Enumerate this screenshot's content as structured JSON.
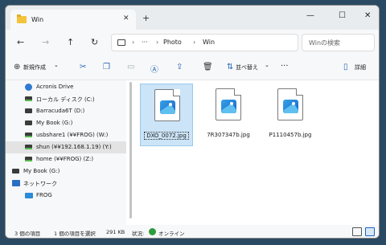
{
  "window": {
    "tab_title": "Win",
    "tab_close": "✕",
    "new_tab": "+",
    "minimize": "—",
    "maximize": "☐",
    "close": "✕"
  },
  "nav": {
    "back": "←",
    "forward": "→",
    "up": "↑",
    "refresh": "↻",
    "breadcrumb_sep1": "›",
    "overflow": "···",
    "breadcrumb_sep2": "›",
    "crumb_photo": "Photo",
    "breadcrumb_sep3": "›",
    "crumb_win": "Win",
    "search_placeholder": "Winの検索"
  },
  "toolbar": {
    "new_label": "新規作成",
    "new_icon": "⊕",
    "new_chevron": "⌄",
    "sort_label": "並べ替え",
    "sort_chevron": "⌄",
    "more": "···",
    "details_label": "詳細"
  },
  "sidebar": {
    "items": [
      {
        "label": "Acronis Drive",
        "icon": "acronis-icon"
      },
      {
        "label": "ローカル ディスク (C:)",
        "icon": "drive-icon"
      },
      {
        "label": "Barracuda6T (D:)",
        "icon": "drive-icon"
      },
      {
        "label": "My Book (G:)",
        "icon": "drive-icon"
      },
      {
        "label": "usbshare1 (¥¥FROG) (W:)",
        "icon": "network-drive-icon"
      },
      {
        "label": "shun (¥¥192.168.1.19) (Y:)",
        "icon": "network-drive-icon"
      },
      {
        "label": "home (¥¥FROG) (Z:)",
        "icon": "network-drive-icon"
      },
      {
        "label": "My Book (G:)",
        "icon": "drive-icon"
      },
      {
        "label": "ネットワーク",
        "icon": "network-icon"
      },
      {
        "label": "FROG",
        "icon": "monitor-icon"
      }
    ]
  },
  "files": [
    {
      "name": "DXO_0072.jpg",
      "selected": true
    },
    {
      "name": "7R307347b.jpg",
      "selected": false
    },
    {
      "name": "P1110457b.jpg",
      "selected": false
    }
  ],
  "status": {
    "item_count": "3 個の項目",
    "selection": "1 個の項目を選択",
    "size": "291 KB",
    "state_label": "状況:",
    "state_value": "オンライン"
  },
  "colors": {
    "accent": "#1a64c7",
    "selection": "#cce4f7",
    "online": "#2e9c3d"
  }
}
